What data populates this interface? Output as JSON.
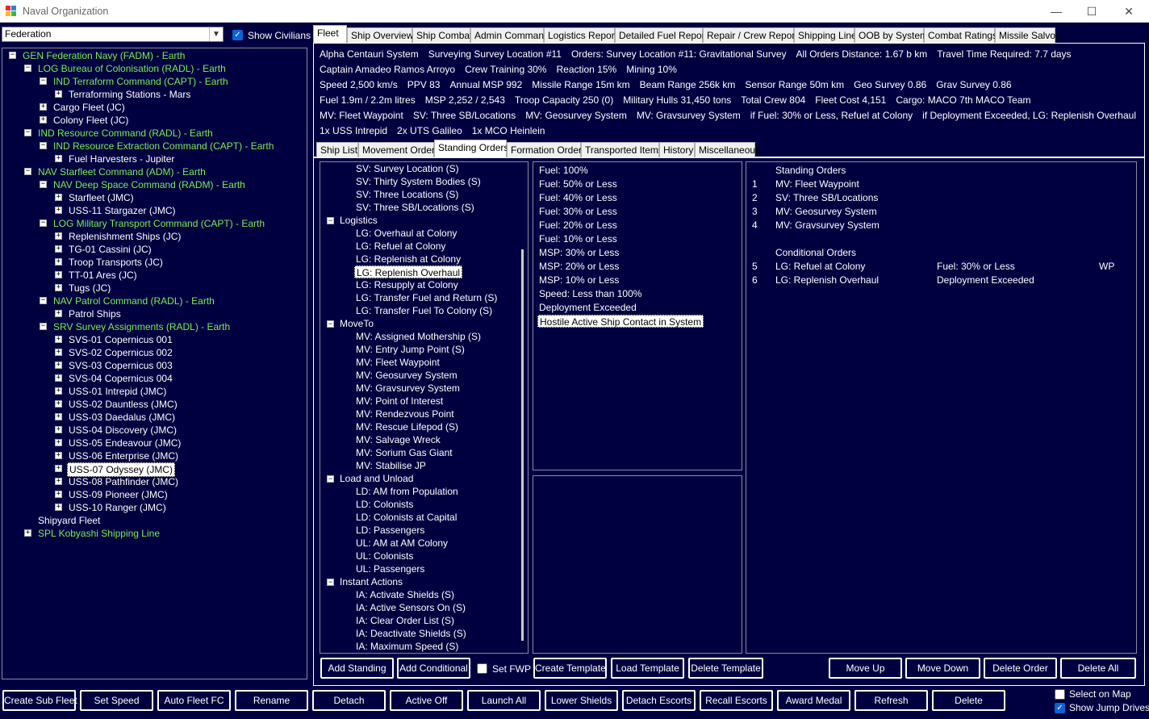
{
  "window": {
    "title": "Naval Organization",
    "minimize": "—",
    "maximize": "☐",
    "close": "✕"
  },
  "left": {
    "race_select": "Federation",
    "show_civilians_label": "Show Civilians",
    "show_civilians_checked": true,
    "tree": [
      {
        "text": "GEN Federation Navy  (FADM)  -  Earth",
        "color": "green",
        "indent": 0,
        "exp": "−"
      },
      {
        "text": "LOG Bureau of Colonisation  (RADL)  -  Earth",
        "color": "green",
        "indent": 1,
        "exp": "−"
      },
      {
        "text": "IND Terraform Command  (CAPT)  -  Earth",
        "color": "green",
        "indent": 2,
        "exp": "−"
      },
      {
        "text": "Terraforming Stations - Mars",
        "color": "white",
        "indent": 3,
        "exp": "+"
      },
      {
        "text": "Cargo Fleet  (JC)",
        "color": "white",
        "indent": 2,
        "exp": "+"
      },
      {
        "text": "Colony Fleet  (JC)",
        "color": "white",
        "indent": 2,
        "exp": "+"
      },
      {
        "text": "IND Resource Command  (RADL)  -  Earth",
        "color": "green",
        "indent": 1,
        "exp": "−"
      },
      {
        "text": "IND Resource Extraction Command  (CAPT)  -  Earth",
        "color": "green",
        "indent": 2,
        "exp": "−"
      },
      {
        "text": "Fuel Harvesters - Jupiter",
        "color": "white",
        "indent": 3,
        "exp": "+"
      },
      {
        "text": "NAV Starfleet Command  (ADM)  -  Earth",
        "color": "green",
        "indent": 1,
        "exp": "−"
      },
      {
        "text": "NAV Deep Space Command  (RADM)  -  Earth",
        "color": "green",
        "indent": 2,
        "exp": "−"
      },
      {
        "text": "Starfleet  (JMC)",
        "color": "white",
        "indent": 3,
        "exp": "+"
      },
      {
        "text": "USS-11 Stargazer  (JMC)",
        "color": "white",
        "indent": 3,
        "exp": "+"
      },
      {
        "text": "LOG Military Transport Command  (CAPT)  -  Earth",
        "color": "green",
        "indent": 2,
        "exp": "−"
      },
      {
        "text": "Replenishment Ships  (JC)",
        "color": "white",
        "indent": 3,
        "exp": "+"
      },
      {
        "text": "TG-01 Cassini  (JC)",
        "color": "white",
        "indent": 3,
        "exp": "+"
      },
      {
        "text": "Troop Transports  (JC)",
        "color": "white",
        "indent": 3,
        "exp": "+"
      },
      {
        "text": "TT-01 Ares  (JC)",
        "color": "white",
        "indent": 3,
        "exp": "+"
      },
      {
        "text": "Tugs  (JC)",
        "color": "white",
        "indent": 3,
        "exp": "+"
      },
      {
        "text": "NAV Patrol Command  (RADL)  -  Earth",
        "color": "green",
        "indent": 2,
        "exp": "−"
      },
      {
        "text": "Patrol Ships",
        "color": "white",
        "indent": 3,
        "exp": "+"
      },
      {
        "text": "SRV Survey Assignments  (RADL)  -  Earth",
        "color": "green",
        "indent": 2,
        "exp": "−"
      },
      {
        "text": "SVS-01 Copernicus 001",
        "color": "white",
        "indent": 3,
        "exp": "+"
      },
      {
        "text": "SVS-02 Copernicus 002",
        "color": "white",
        "indent": 3,
        "exp": "+"
      },
      {
        "text": "SVS-03 Copernicus 003",
        "color": "white",
        "indent": 3,
        "exp": "+"
      },
      {
        "text": "SVS-04 Copernicus 004",
        "color": "white",
        "indent": 3,
        "exp": "+"
      },
      {
        "text": "USS-01 Intrepid  (JMC)",
        "color": "white",
        "indent": 3,
        "exp": "+"
      },
      {
        "text": "USS-02 Dauntless  (JMC)",
        "color": "white",
        "indent": 3,
        "exp": "+"
      },
      {
        "text": "USS-03 Daedalus  (JMC)",
        "color": "white",
        "indent": 3,
        "exp": "+"
      },
      {
        "text": "USS-04 Discovery  (JMC)",
        "color": "white",
        "indent": 3,
        "exp": "+"
      },
      {
        "text": "USS-05 Endeavour  (JMC)",
        "color": "white",
        "indent": 3,
        "exp": "+"
      },
      {
        "text": "USS-06 Enterprise  (JMC)",
        "color": "white",
        "indent": 3,
        "exp": "+"
      },
      {
        "text": "USS-07 Odyssey  (JMC)",
        "color": "white",
        "indent": 3,
        "exp": "+",
        "selected": true
      },
      {
        "text": "USS-08 Pathfinder  (JMC)",
        "color": "white",
        "indent": 3,
        "exp": "+"
      },
      {
        "text": "USS-09 Pioneer  (JMC)",
        "color": "white",
        "indent": 3,
        "exp": "+"
      },
      {
        "text": "USS-10 Ranger  (JMC)",
        "color": "white",
        "indent": 3,
        "exp": "+"
      },
      {
        "text": "Shipyard Fleet",
        "color": "white",
        "indent": 1,
        "exp": ""
      },
      {
        "text": "SPL Kobyashi Shipping Line",
        "color": "green",
        "indent": 1,
        "exp": "+"
      }
    ]
  },
  "top_tabs": [
    "Fleet",
    "Ship Overview",
    "Ship Combat",
    "Admin Command",
    "Logistics Report",
    "Detailed Fuel Report",
    "Repair / Crew Report",
    "Shipping Line",
    "OOB by System",
    "Combat Ratings",
    "Missile Salvos"
  ],
  "top_tab_active": 0,
  "info": {
    "row1": [
      "Alpha Centauri System",
      "Surveying Survey Location #11",
      "Orders: Survey Location #11: Gravitational Survey",
      "All Orders Distance: 1.67 b km",
      "Travel Time Required: 7.7 days"
    ],
    "row2": [
      "Captain Amadeo Ramos Arroyo",
      "Crew Training 30%",
      "Reaction 15%",
      "Mining 10%"
    ],
    "row3": [
      "Speed 2,500 km/s",
      "PPV 83",
      "Annual MSP 992",
      "Missile Range 15m  km",
      "Beam Range 256k  km",
      "Sensor Range 50m  km",
      "Geo Survey 0.86",
      "Grav Survey 0.86"
    ],
    "row4": [
      "Fuel 1.9m / 2.2m litres",
      "MSP 2,252 / 2,543",
      "Troop Capacity 250 (0)",
      "Military Hulls 31,450 tons",
      "Total Crew 804",
      "Fleet Cost 4,151",
      "Cargo: MACO 7th MACO Team"
    ],
    "row5": [
      "MV: Fleet Waypoint",
      "SV: Three SB/Locations",
      "MV: Geosurvey System",
      "MV: Gravsurvey System",
      "if Fuel: 30% or Less, Refuel at Colony",
      "if Deployment Exceeded, LG: Replenish Overhaul"
    ],
    "row6": [
      "1x USS Intrepid",
      "2x UTS Galileo",
      "1x MCO Heinlein"
    ]
  },
  "sub_tabs": [
    "Ship List",
    "Movement Orders",
    "Standing Orders",
    "Formation Orders",
    "Transported Items",
    "History",
    "Miscellaneous"
  ],
  "sub_tab_active": 2,
  "orders_list": [
    {
      "t": "SV: Survey Location (S)",
      "lvl": 1
    },
    {
      "t": "SV: Thirty System Bodies (S)",
      "lvl": 1
    },
    {
      "t": "SV: Three Locations (S)",
      "lvl": 1
    },
    {
      "t": "SV: Three SB/Locations (S)",
      "lvl": 1
    },
    {
      "t": "Logistics",
      "lvl": 0
    },
    {
      "t": "LG: Overhaul at Colony",
      "lvl": 1
    },
    {
      "t": "LG: Refuel at Colony",
      "lvl": 1
    },
    {
      "t": "LG: Replenish at Colony",
      "lvl": 1
    },
    {
      "t": "LG: Replenish Overhaul",
      "lvl": 1,
      "sel": true
    },
    {
      "t": "LG: Resupply at Colony",
      "lvl": 1
    },
    {
      "t": "LG: Transfer Fuel and Return (S)",
      "lvl": 1
    },
    {
      "t": "LG: Transfer Fuel To Colony (S)",
      "lvl": 1
    },
    {
      "t": "MoveTo",
      "lvl": 0
    },
    {
      "t": "MV: Assigned Mothership (S)",
      "lvl": 1
    },
    {
      "t": "MV: Entry Jump Point (S)",
      "lvl": 1
    },
    {
      "t": "MV: Fleet Waypoint",
      "lvl": 1
    },
    {
      "t": "MV: Geosurvey System",
      "lvl": 1
    },
    {
      "t": "MV: Gravsurvey System",
      "lvl": 1
    },
    {
      "t": "MV: Point of Interest",
      "lvl": 1
    },
    {
      "t": "MV: Rendezvous Point",
      "lvl": 1
    },
    {
      "t": "MV: Rescue Lifepod (S)",
      "lvl": 1
    },
    {
      "t": "MV: Salvage Wreck",
      "lvl": 1
    },
    {
      "t": "MV: Sorium Gas Giant",
      "lvl": 1
    },
    {
      "t": "MV: Stabilise JP",
      "lvl": 1
    },
    {
      "t": "Load and Unload",
      "lvl": 0
    },
    {
      "t": "LD: AM from Population",
      "lvl": 1
    },
    {
      "t": "LD: Colonists",
      "lvl": 1
    },
    {
      "t": "LD: Colonists at Capital",
      "lvl": 1
    },
    {
      "t": "LD: Passengers",
      "lvl": 1
    },
    {
      "t": "UL: AM at AM Colony",
      "lvl": 1
    },
    {
      "t": "UL: Colonists",
      "lvl": 1
    },
    {
      "t": "UL: Passengers",
      "lvl": 1
    },
    {
      "t": "Instant Actions",
      "lvl": 0
    },
    {
      "t": "IA: Activate Shields (S)",
      "lvl": 1
    },
    {
      "t": "IA: Active Sensors On (S)",
      "lvl": 1
    },
    {
      "t": "IA: Clear Order List (S)",
      "lvl": 1
    },
    {
      "t": "IA: Deactivate Shields (S)",
      "lvl": 1
    },
    {
      "t": "IA: Maximum Speed (S)",
      "lvl": 1
    }
  ],
  "conditions": [
    "Fuel: 100%",
    "Fuel: 50% or Less",
    "Fuel: 40% or Less",
    "Fuel: 30% or Less",
    "Fuel: 20% or Less",
    "Fuel: 10% or Less",
    "MSP: 30% or Less",
    "MSP: 20% or Less",
    "MSP: 10% or Less",
    "Speed: Less than 100%",
    "Deployment Exceeded",
    "Hostile Active Ship Contact in System"
  ],
  "conditions_selected": 11,
  "standing": {
    "header": "Standing Orders",
    "items": [
      {
        "n": "1",
        "t": "MV: Fleet Waypoint"
      },
      {
        "n": "2",
        "t": "SV: Three SB/Locations"
      },
      {
        "n": "3",
        "t": "MV: Geosurvey System"
      },
      {
        "n": "4",
        "t": "MV: Gravsurvey System"
      }
    ],
    "cond_header": "Conditional Orders",
    "cond_items": [
      {
        "n": "5",
        "t": "LG: Refuel at Colony",
        "c": "Fuel: 30% or Less",
        "x": "WP"
      },
      {
        "n": "6",
        "t": "LG: Replenish Overhaul",
        "c": "Deployment Exceeded",
        "x": ""
      }
    ]
  },
  "order_buttons": {
    "add_standing": "Add Standing",
    "add_conditional": "Add Conditional",
    "set_fwp": "Set FWP",
    "create_template": "Create Template",
    "load_template": "Load Template",
    "delete_template": "Delete Template",
    "move_up": "Move Up",
    "move_down": "Move Down",
    "delete_order": "Delete Order",
    "delete_all": "Delete All"
  },
  "bottom_buttons": [
    "Create Sub Fleet",
    "Set Speed",
    "Auto Fleet FC",
    "Rename",
    "Detach",
    "Active Off",
    "Launch All",
    "Lower Shields",
    "Detach Escorts",
    "Recall Escorts",
    "Award Medal",
    "Refresh",
    "Delete"
  ],
  "select_on_map": {
    "label": "Select on Map",
    "checked": false
  },
  "show_jump_drives": {
    "label": "Show Jump Drives",
    "checked": true
  },
  "colors": {
    "bg": "#000040",
    "tree_green": "#77ee55",
    "checkbox_blue": "#0a64d8"
  }
}
